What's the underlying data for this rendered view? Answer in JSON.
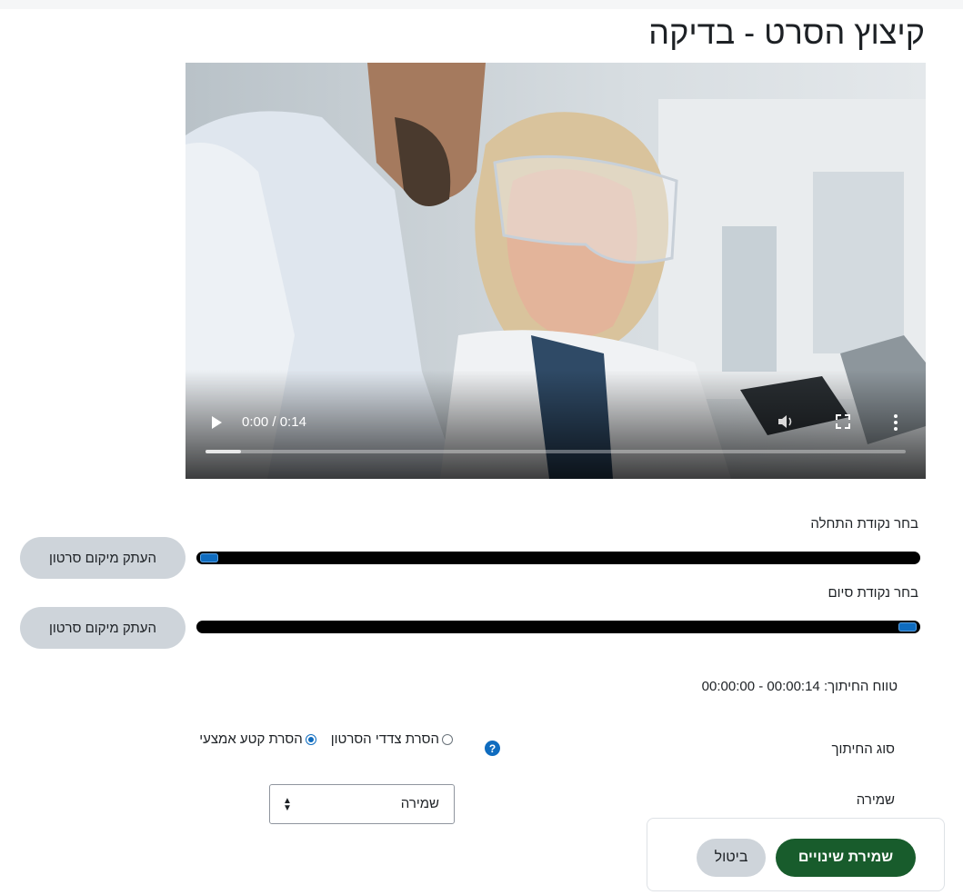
{
  "page": {
    "title": "קיצוץ הסרט - בדיקה"
  },
  "video": {
    "current_time": "0:00",
    "duration": "0:14",
    "progress": 0.05,
    "icons": [
      "play-icon",
      "volume-icon",
      "fullscreen-icon",
      "more-options-icon"
    ]
  },
  "trim": {
    "start_label": "בחר נקודת התחלה",
    "end_label": "בחר נקודת סיום",
    "copy_button_label": "העתק מיקום סרטון",
    "start_value": 0,
    "end_value": 1
  },
  "range": {
    "label": "טווח החיתוך:",
    "start": "00:00:00",
    "separator": "-",
    "end": "00:00:14"
  },
  "cut_type": {
    "label": "סוג החיתוך",
    "options": [
      {
        "label": "הסרת צדדי הסרטון",
        "checked": false
      },
      {
        "label": "הסרת קטע אמצעי",
        "checked": true
      }
    ]
  },
  "save": {
    "label": "שמירה",
    "selected": "שמירה"
  },
  "footer": {
    "save_changes": "שמירת שינויים",
    "cancel": "ביטול"
  },
  "colors": {
    "accent": "#0f6cbf",
    "primary_button": "#185c2c",
    "secondary_button": "#ced4da"
  }
}
